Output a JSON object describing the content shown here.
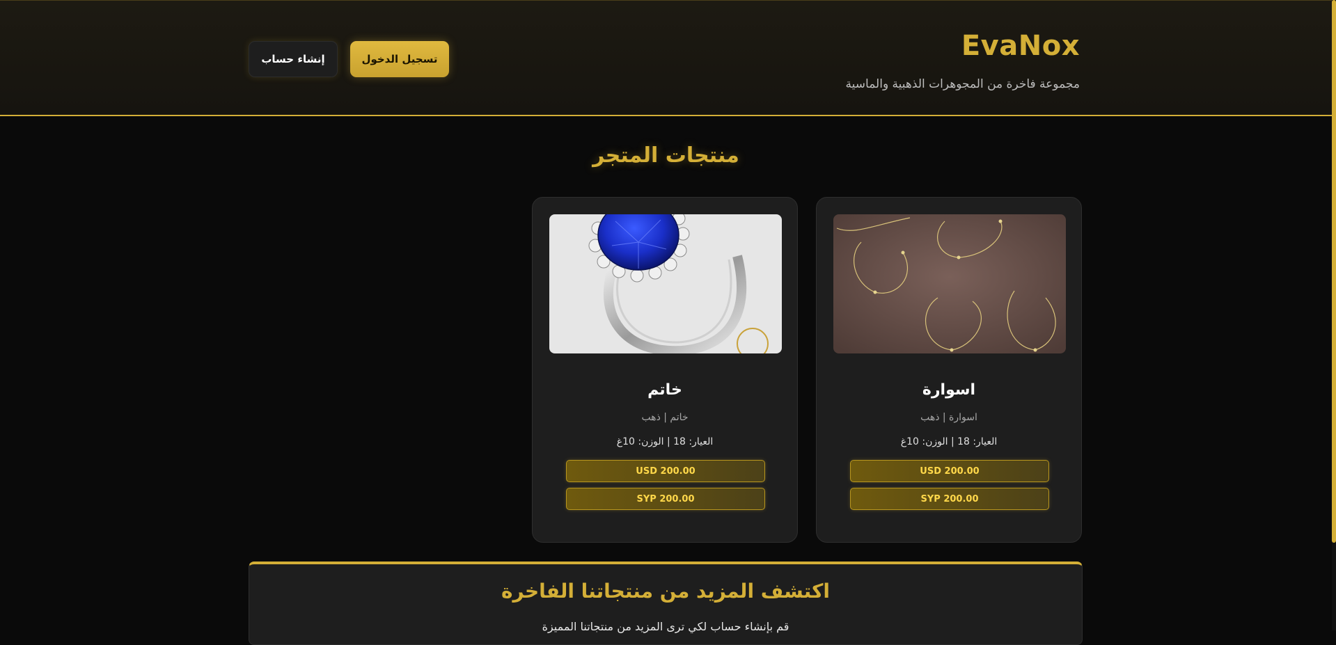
{
  "header": {
    "brand": "EvaNox",
    "subtitle": "مجموعة فاخرة من المجوهرات الذهبية والماسية",
    "login_label": "تسجيل الدخول",
    "register_label": "إنشاء حساب"
  },
  "products_section": {
    "title": "منتجات المتجر"
  },
  "products": [
    {
      "name": "اسوارة",
      "category": "اسوارة | ذهب",
      "specs": "العيار: 18 | الوزن: 10غ",
      "price_usd": "USD 200.00",
      "price_syp": "SYP 200.00"
    },
    {
      "name": "خاتم",
      "category": "خاتم | ذهب",
      "specs": "العيار: 18 | الوزن: 10غ",
      "price_usd": "USD 200.00",
      "price_syp": "SYP 200.00"
    }
  ],
  "more": {
    "title": "اكتشف المزيد من منتجاتنا الفاخرة",
    "text": "قم بإنشاء حساب لكي ترى المزيد من منتجاتنا المميزة"
  },
  "colors": {
    "accent": "#d4af37",
    "background": "#0a0a0a",
    "card": "#1e1e1e"
  }
}
